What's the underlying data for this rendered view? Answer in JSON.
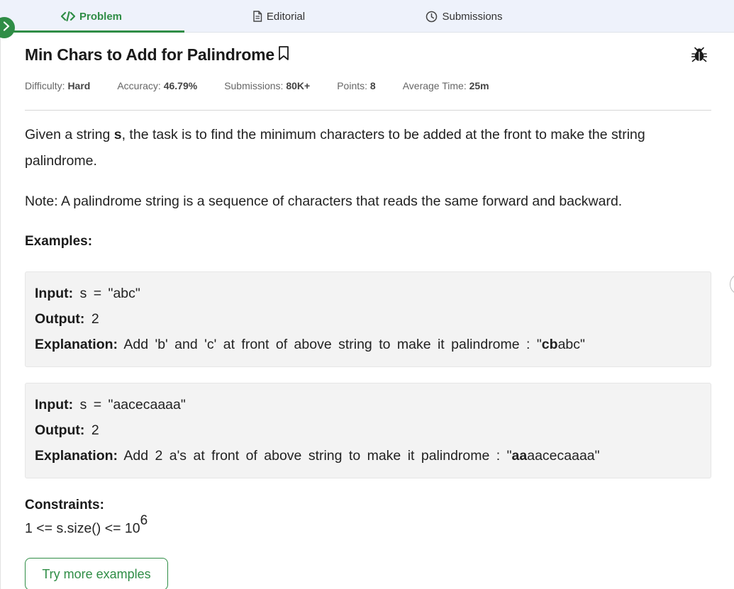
{
  "tabs": [
    {
      "label": "Problem",
      "icon": "code-icon"
    },
    {
      "label": "Editorial",
      "icon": "document-icon"
    },
    {
      "label": "Submissions",
      "icon": "clock-icon"
    }
  ],
  "problem": {
    "title": "Min Chars to Add for Palindrome",
    "meta": [
      {
        "label": "Difficulty:",
        "value": "Hard"
      },
      {
        "label": "Accuracy:",
        "value": "46.79%"
      },
      {
        "label": "Submissions:",
        "value": "80K+"
      },
      {
        "label": "Points:",
        "value": "8"
      },
      {
        "label": "Average Time:",
        "value": "25m"
      }
    ],
    "statement": {
      "before": "Given a string ",
      "var": "s",
      "after": ", the task is to find the minimum characters to be added at the front to make the string palindrome."
    },
    "note": "Note: A palindrome string is a sequence of characters that reads the same forward and backward.",
    "examples_heading": "Examples:",
    "examples": [
      {
        "input_label": "Input:",
        "input": "s = \"abc\"",
        "output_label": "Output:",
        "output": "2",
        "explanation_label": "Explanation:",
        "explanation_text": "Add 'b' and 'c' at front of above string to make it palindrome : \"",
        "explanation_bold": "cb",
        "explanation_tail": "abc\""
      },
      {
        "input_label": "Input:",
        "input": "s = \"aacecaaaa\"",
        "output_label": "Output:",
        "output": "2",
        "explanation_label": "Explanation:",
        "explanation_text": "Add 2 a's at front of above string to make it palindrome : \"",
        "explanation_bold": "aa",
        "explanation_tail": "aacecaaaa\""
      }
    ],
    "constraints_heading": "Constraints:",
    "constraint_text": "1 <= s.size() <= 10",
    "constraint_exp": "6",
    "try_button": "Try more examples"
  },
  "colors": {
    "accent": "#2f8d46",
    "tab_bg": "#eef2fb",
    "example_bg": "#f3f3f3"
  }
}
